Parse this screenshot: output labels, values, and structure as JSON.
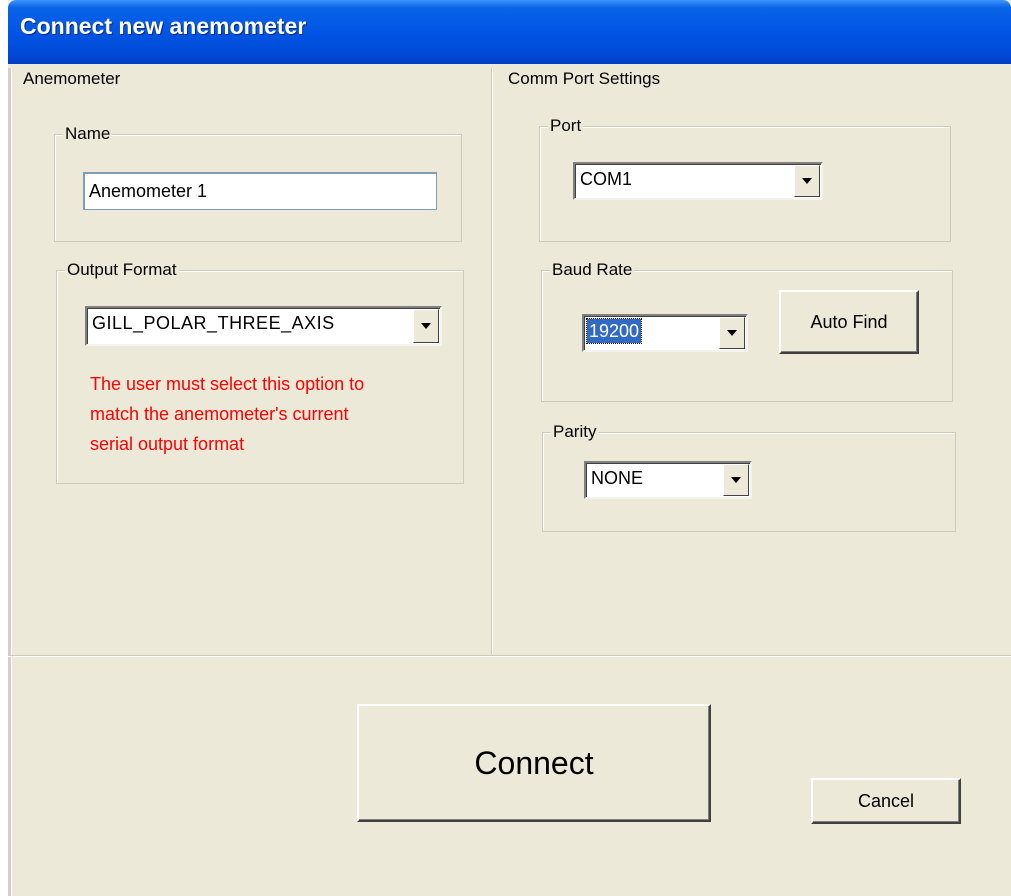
{
  "window": {
    "title": "Connect new anemometer"
  },
  "anemometer": {
    "group_label": "Anemometer",
    "name_group_label": "Name",
    "name_value": "Anemometer 1",
    "output_group_label": "Output Format",
    "output_format": "GILL_POLAR_THREE_AXIS",
    "note": [
      "The user must select this option to",
      "match the anemometer's current",
      "serial output format"
    ],
    "note_color": "#ff0000"
  },
  "comm": {
    "group_label": "Comm Port Settings",
    "port_group_label": "Port",
    "port_value": "COM1",
    "baud_group_label": "Baud Rate",
    "baud_value": "19200",
    "auto_find_label": "Auto Find",
    "parity_group_label": "Parity",
    "parity_value": "NONE"
  },
  "actions": {
    "connect_label": "Connect",
    "cancel_label": "Cancel"
  },
  "colors": {
    "titlebar": "#0055e5",
    "dialog_bg": "#ece9d8",
    "selection": "#316ac5"
  }
}
